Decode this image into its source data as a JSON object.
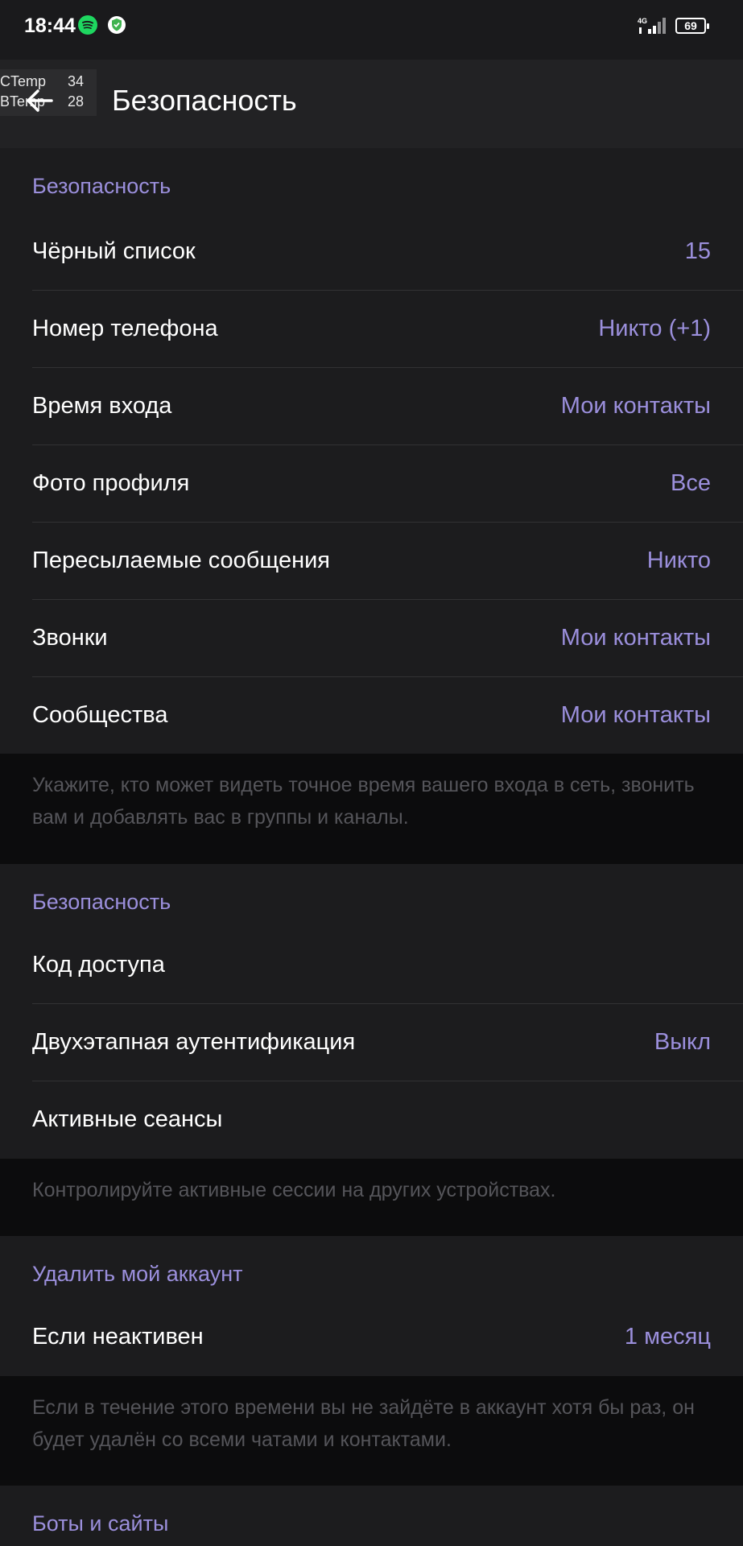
{
  "status_bar": {
    "time": "18:44",
    "network": "4G",
    "battery": "69",
    "icons": [
      "spotify-icon",
      "shield-icon",
      "signal-icon",
      "battery-icon"
    ]
  },
  "overlay": {
    "rows": [
      {
        "key": "CTemp",
        "value": "34"
      },
      {
        "key": "BTemp",
        "value": "28"
      }
    ]
  },
  "header": {
    "title": "Безопасность"
  },
  "colors": {
    "accent": "#9b8fdc",
    "background": "#1c1c1e",
    "hint_background": "#0c0c0d"
  },
  "sections": [
    {
      "header": "Безопасность",
      "rows": [
        {
          "label": "Чёрный список",
          "value": "15"
        },
        {
          "label": "Номер телефона",
          "value": "Никто (+1)"
        },
        {
          "label": "Время входа",
          "value": "Мои контакты"
        },
        {
          "label": "Фото профиля",
          "value": "Все"
        },
        {
          "label": "Пересылаемые сообщения",
          "value": "Никто"
        },
        {
          "label": "Звонки",
          "value": "Мои контакты"
        },
        {
          "label": "Сообщества",
          "value": "Мои контакты"
        }
      ],
      "hint": "Укажите, кто может видеть точное время вашего входа в сеть, звонить вам и добавлять вас в группы и каналы."
    },
    {
      "header": "Безопасность",
      "rows": [
        {
          "label": "Код доступа",
          "value": ""
        },
        {
          "label": "Двухэтапная аутентификация",
          "value": "Выкл"
        },
        {
          "label": "Активные сеансы",
          "value": ""
        }
      ],
      "hint": "Контролируйте активные сессии на других устройствах."
    },
    {
      "header": "Удалить мой аккаунт",
      "rows": [
        {
          "label": "Если неактивен",
          "value": "1 месяц"
        }
      ],
      "hint": "Если в течение этого времени вы не зайдёте в аккаунт хотя бы раз, он будет удалён со всеми чатами и контактами."
    },
    {
      "header": "Боты и сайты",
      "rows": []
    }
  ]
}
